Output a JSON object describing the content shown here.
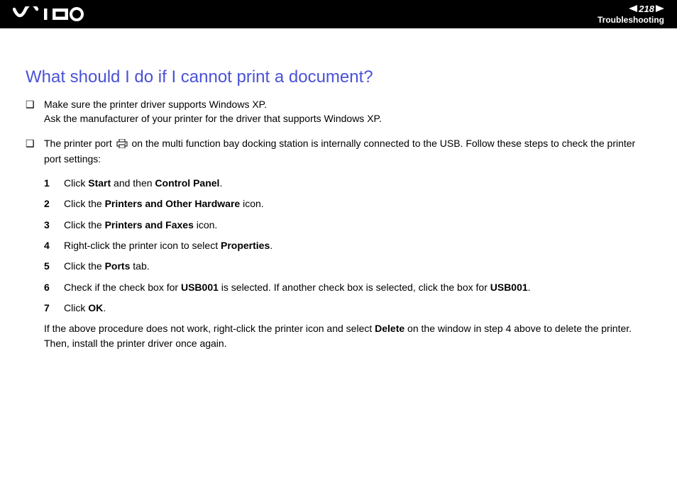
{
  "header": {
    "page_number": "218",
    "section": "Troubleshooting"
  },
  "heading": "What should I do if I cannot print a document?",
  "bullet1": {
    "line1": "Make sure the printer driver supports Windows XP.",
    "line2": "Ask the manufacturer of your printer for the driver that supports Windows XP."
  },
  "bullet2": {
    "pre": "The printer port ",
    "post": " on the multi function bay docking station is internally connected to the USB. Follow these steps to check the printer port settings:"
  },
  "steps": [
    {
      "num": "1",
      "t1": "Click ",
      "b1": "Start",
      "t2": " and then ",
      "b2": "Control Panel",
      "t3": "."
    },
    {
      "num": "2",
      "t1": "Click the ",
      "b1": "Printers and Other Hardware",
      "t2": " icon."
    },
    {
      "num": "3",
      "t1": "Click the ",
      "b1": "Printers and Faxes",
      "t2": " icon."
    },
    {
      "num": "4",
      "t1": "Right-click the printer icon to select ",
      "b1": "Properties",
      "t2": "."
    },
    {
      "num": "5",
      "t1": "Click the ",
      "b1": "Ports",
      "t2": " tab."
    },
    {
      "num": "6",
      "t1": "Check if the check box for ",
      "b1": "USB001",
      "t2": " is selected. If another check box is selected, click the box for ",
      "b2": "USB001",
      "t3": "."
    },
    {
      "num": "7",
      "t1": "Click ",
      "b1": "OK",
      "t2": "."
    }
  ],
  "closing": {
    "t1": "If the above procedure does not work, right-click the printer icon and select ",
    "b1": "Delete",
    "t2": " on the window in step 4 above to delete the printer. Then, install the printer driver once again."
  }
}
